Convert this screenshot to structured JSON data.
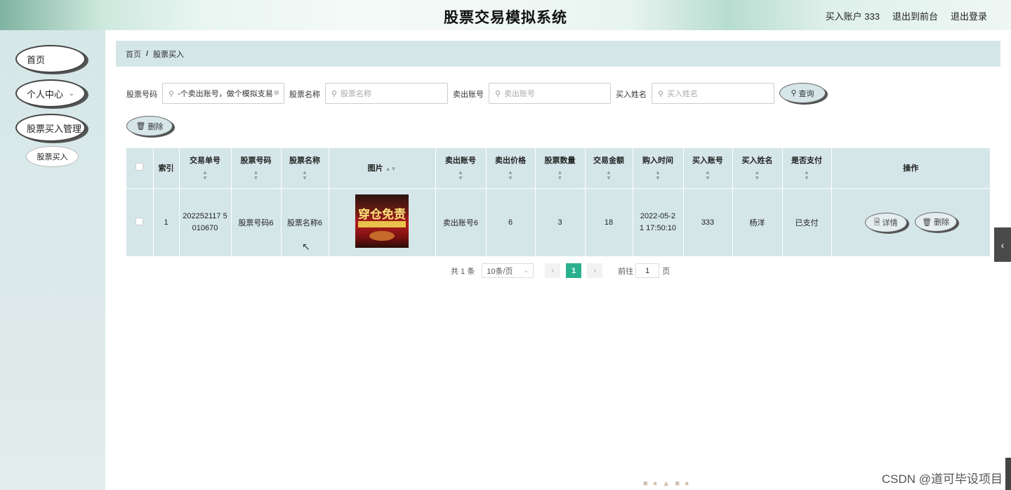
{
  "header": {
    "title": "股票交易模拟系统",
    "account_label": "买入账户 333",
    "front_link": "退出到前台",
    "logout_link": "退出登录"
  },
  "sidebar": {
    "items": [
      {
        "label": "首页"
      },
      {
        "label": "个人中心"
      },
      {
        "label": "股票买入管理"
      },
      {
        "label": "股票买入"
      }
    ]
  },
  "breadcrumb": {
    "home": "首页",
    "sep": "/",
    "current": "股票买入"
  },
  "search": {
    "code_label": "股票号码",
    "code_value": "-个卖出账号，做个模拟支易",
    "name_label": "股票名称",
    "name_placeholder": "股票名称",
    "seller_label": "卖出账号",
    "seller_placeholder": "卖出账号",
    "buyer_label": "买入姓名",
    "buyer_placeholder": "买入姓名",
    "query_button": "查询",
    "delete_button": "删除"
  },
  "table": {
    "headers": [
      "索引",
      "交易单号",
      "股票号码",
      "股票名称",
      "图片",
      "卖出账号",
      "卖出价格",
      "股票数量",
      "交易金额",
      "购入时间",
      "买入账号",
      "买入姓名",
      "是否支付",
      "操作"
    ],
    "rows": [
      {
        "index": "1",
        "order_no": "202252117 5010670",
        "code": "股票号码6",
        "name": "股票名称6",
        "image_text": "穿仓免责",
        "seller": "卖出账号6",
        "price": "6",
        "quantity": "3",
        "amount": "18",
        "time": "2022-05-2 1 17:50:10",
        "buyer_account": "333",
        "buyer_name": "杨洋",
        "paid": "已支付",
        "detail_button": "详情",
        "delete_button": "删除"
      }
    ]
  },
  "pagination": {
    "total": "共 1 条",
    "page_size": "10条/页",
    "current_page": "1",
    "goto_label": "前往",
    "goto_value": "1",
    "page_suffix": "页"
  },
  "watermark": "CSDN @道可毕设项目"
}
